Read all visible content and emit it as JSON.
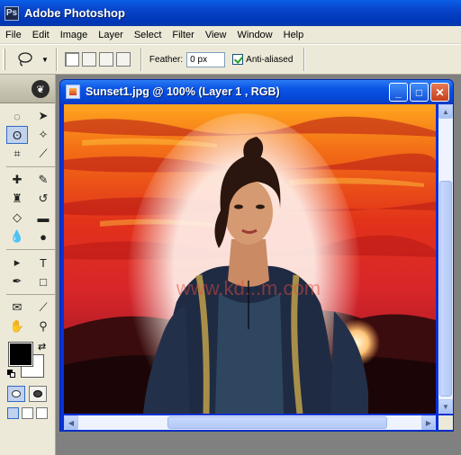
{
  "app": {
    "title": "Adobe Photoshop",
    "icon": "photoshop-app-icon"
  },
  "menu": [
    "File",
    "Edit",
    "Image",
    "Layer",
    "Select",
    "Filter",
    "View",
    "Window",
    "Help"
  ],
  "options_bar": {
    "tool_icon": "lasso-icon",
    "selection_modes": [
      "new-selection-icon",
      "add-to-selection-icon",
      "subtract-from-selection-icon",
      "intersect-selection-icon"
    ],
    "feather_label": "Feather:",
    "feather_value": "0 px",
    "anti_aliased_label": "Anti-aliased",
    "anti_aliased_checked": true
  },
  "toolbox": {
    "tools": [
      {
        "name": "marquee-tool",
        "icon": "marquee-icon",
        "glyph": "◌"
      },
      {
        "name": "move-tool",
        "icon": "move-icon",
        "glyph": "➤"
      },
      {
        "name": "lasso-tool",
        "icon": "lasso-icon",
        "glyph": "ʘ",
        "active": true
      },
      {
        "name": "magic-wand-tool",
        "icon": "magic-wand-icon",
        "glyph": "✧"
      },
      {
        "name": "crop-tool",
        "icon": "crop-icon",
        "glyph": "⌗"
      },
      {
        "name": "slice-tool",
        "icon": "slice-icon",
        "glyph": "⟋"
      },
      {
        "name": "healing-brush-tool",
        "icon": "bandage-icon",
        "glyph": "✚"
      },
      {
        "name": "brush-tool",
        "icon": "brush-icon",
        "glyph": "✎"
      },
      {
        "name": "clone-stamp-tool",
        "icon": "stamp-icon",
        "glyph": "♜"
      },
      {
        "name": "history-brush-tool",
        "icon": "history-brush-icon",
        "glyph": "↺"
      },
      {
        "name": "eraser-tool",
        "icon": "eraser-icon",
        "glyph": "◇"
      },
      {
        "name": "gradient-tool",
        "icon": "gradient-icon",
        "glyph": "▬"
      },
      {
        "name": "blur-tool",
        "icon": "drop-icon",
        "glyph": "💧"
      },
      {
        "name": "dodge-tool",
        "icon": "dodge-icon",
        "glyph": "●"
      },
      {
        "name": "path-selection-tool",
        "icon": "path-select-icon",
        "glyph": "▸"
      },
      {
        "name": "type-tool",
        "icon": "type-icon",
        "glyph": "T"
      },
      {
        "name": "pen-tool",
        "icon": "pen-icon",
        "glyph": "✒"
      },
      {
        "name": "shape-tool",
        "icon": "rectangle-icon",
        "glyph": "□"
      },
      {
        "name": "notes-tool",
        "icon": "notes-icon",
        "glyph": "✉"
      },
      {
        "name": "eyedropper-tool",
        "icon": "eyedropper-icon",
        "glyph": "⟋"
      },
      {
        "name": "hand-tool",
        "icon": "hand-icon",
        "glyph": "✋"
      },
      {
        "name": "zoom-tool",
        "icon": "magnifier-icon",
        "glyph": "⚲"
      }
    ],
    "foreground_color": "#000000",
    "background_color": "#ffffff"
  },
  "document": {
    "title": "Sunset1.jpg @ 100% (Layer 1 , RGB)",
    "watermark": "www.kd...m.com",
    "minimize_glyph": "_",
    "maximize_glyph": "□",
    "close_glyph": "✕"
  },
  "colors": {
    "xp_blue": "#0831d9",
    "menu_bg": "#ece9d8",
    "sky_orange": "#f08020",
    "sky_red": "#d02a1c"
  }
}
